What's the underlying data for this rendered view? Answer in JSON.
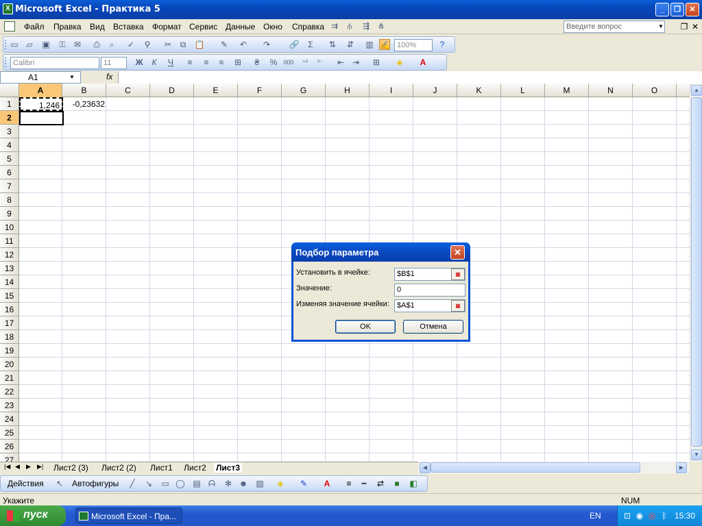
{
  "window": {
    "title": "Microsoft Excel - Практика 5",
    "app_icon": "X"
  },
  "menu": {
    "items": [
      "Файл",
      "Правка",
      "Вид",
      "Вставка",
      "Формат",
      "Сервис",
      "Данные",
      "Окно",
      "Справка"
    ],
    "help_placeholder": "Введите вопрос"
  },
  "toolbar": {
    "zoom": "100%",
    "font_name": "Calibri",
    "font_size": "11",
    "bold": "Ж",
    "italic": "К",
    "underline": "Ч",
    "percent": "%",
    "thousands": "000"
  },
  "formula_bar": {
    "name_box": "A1",
    "fx": "fx",
    "content": ""
  },
  "grid": {
    "columns": [
      "A",
      "B",
      "C",
      "D",
      "E",
      "F",
      "G",
      "H",
      "I",
      "J",
      "K",
      "L",
      "M",
      "N",
      "O"
    ],
    "rows": [
      "1",
      "2",
      "3",
      "4",
      "5",
      "6",
      "7",
      "8",
      "9",
      "10",
      "11",
      "12",
      "13",
      "14",
      "15",
      "16",
      "17",
      "18",
      "19",
      "20",
      "21",
      "22",
      "23",
      "24",
      "25",
      "26",
      "27"
    ],
    "cells": {
      "A1": "1,246",
      "B1": "-0,23632"
    }
  },
  "sheets": {
    "tabs": [
      "Лист2 (3)",
      "Лист2 (2)",
      "Лист1",
      "Лист2",
      "Лист3"
    ],
    "active": "Лист3"
  },
  "drawing_toolbar": {
    "actions": "Действия",
    "autoshapes": "Автофигуры"
  },
  "status": {
    "mode": "Укажите",
    "num": "NUM"
  },
  "dialog": {
    "title": "Подбор параметра",
    "set_cell_label": "Установить в ячейке:",
    "set_cell_value": "$B$1",
    "to_value_label": "Значение:",
    "to_value": "0",
    "changing_cell_label": "Изменяя значение ячейки:",
    "changing_cell_value": "$A$1",
    "ok": "OK",
    "cancel": "Отмена"
  },
  "taskbar": {
    "start": "пуск",
    "item": "Microsoft Excel - Пра...",
    "lang": "EN",
    "clock": "15:30"
  }
}
